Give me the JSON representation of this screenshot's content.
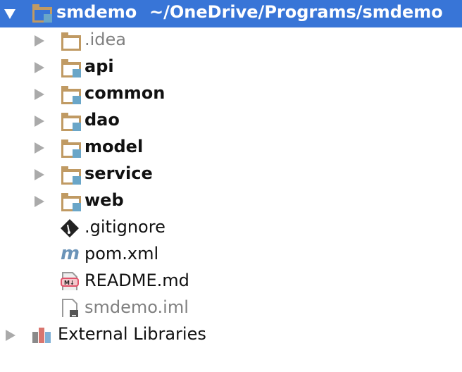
{
  "root": {
    "name": "smdemo",
    "path": "~/OneDrive/Programs/smdemo",
    "expanded": true,
    "selected": true
  },
  "children": [
    {
      "name": ".idea",
      "type": "folder",
      "module": false,
      "style": "gray"
    },
    {
      "name": "api",
      "type": "folder",
      "module": true,
      "style": "bold"
    },
    {
      "name": "common",
      "type": "folder",
      "module": true,
      "style": "bold"
    },
    {
      "name": "dao",
      "type": "folder",
      "module": true,
      "style": "bold"
    },
    {
      "name": "model",
      "type": "folder",
      "module": true,
      "style": "bold"
    },
    {
      "name": "service",
      "type": "folder",
      "module": true,
      "style": "bold"
    },
    {
      "name": "web",
      "type": "folder",
      "module": true,
      "style": "bold"
    },
    {
      "name": ".gitignore",
      "type": "git-file",
      "style": "normal"
    },
    {
      "name": "pom.xml",
      "type": "maven-file",
      "style": "normal"
    },
    {
      "name": "README.md",
      "type": "markdown-file",
      "style": "normal"
    },
    {
      "name": "smdemo.iml",
      "type": "iml-file",
      "style": "gray"
    }
  ],
  "external_libraries": {
    "label": "External Libraries",
    "expanded": false
  },
  "colors": {
    "selection": "#3875d7",
    "folder": "#c09a63",
    "module_badge": "#6aa6c8",
    "arrow": "#aaaaaa"
  }
}
